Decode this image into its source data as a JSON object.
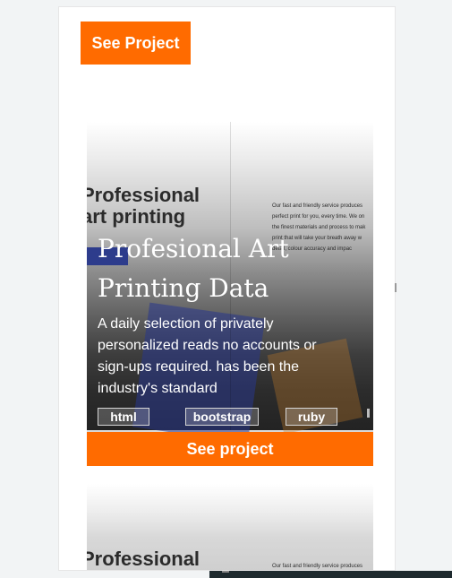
{
  "header": {
    "see_project_label": "See Project"
  },
  "card": {
    "background_image": {
      "title_lines": [
        "Professional",
        "art printing"
      ],
      "paragraph_lines": [
        "Our fast and friendly service produces",
        "perfect print for you, every time. We on",
        "the finest materials and process to mak",
        "print that will take your breath away w",
        "detail, colour accuracy and impac"
      ]
    },
    "title_lines": [
      "Profesional Art",
      "Printing Data"
    ],
    "description_lines": [
      "A daily selection of privately",
      "personalized reads no accounts or",
      "sign-ups required. has been the",
      "industry's standard"
    ],
    "tags": [
      "html",
      "bootstrap",
      "ruby"
    ],
    "cta_label": "See project"
  },
  "card2": {
    "title": "Professional",
    "paragraph": "Our fast and friendly service produces"
  },
  "colors": {
    "accent": "#ff6b00",
    "text_light": "#ffffff",
    "text_dark": "#2b2b2b"
  }
}
